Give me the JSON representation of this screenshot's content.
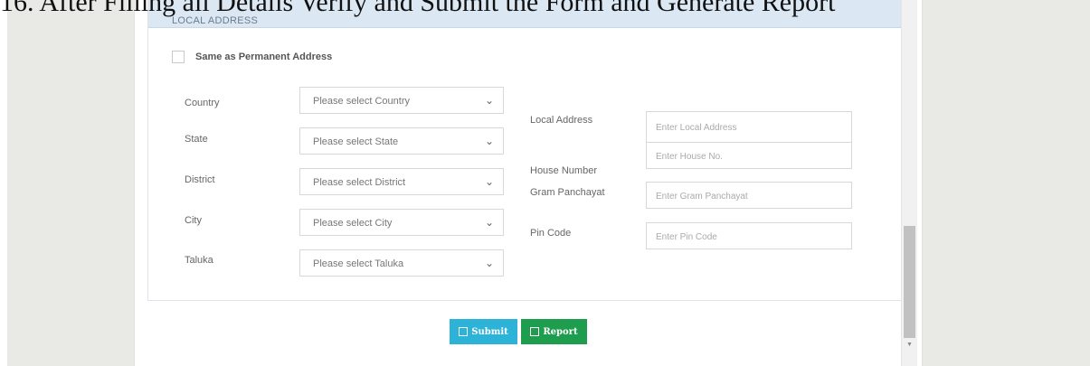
{
  "heading": "16. After Filling all Details Verify and Submit the Form and Generate Report",
  "section_title": "LOCAL ADDRESS",
  "same_as_permanent_label": "Same as Permanent Address",
  "left_fields": [
    {
      "label": "Country",
      "value": "Please select Country"
    },
    {
      "label": "State",
      "value": "Please select State"
    },
    {
      "label": "District",
      "value": "Please select District"
    },
    {
      "label": "City",
      "value": "Please select City"
    },
    {
      "label": "Taluka",
      "value": "Please select Taluka"
    }
  ],
  "right_fields": [
    {
      "label": "Local Address",
      "placeholder": "Enter Local Address"
    },
    {
      "label": "House Number",
      "placeholder": "Enter House No."
    },
    {
      "label": "Gram Panchayat",
      "placeholder": "Enter Gram Panchayat"
    },
    {
      "label": "Pin Code",
      "placeholder": "Enter Pin Code"
    }
  ],
  "buttons": {
    "submit": "Submit",
    "report": "Report"
  },
  "colors": {
    "header_bg": "#dbe8f4",
    "submit_bg": "#2eb3d8",
    "report_bg": "#1e9d4f"
  },
  "icons": {
    "select_arrow": "chevron-down-icon",
    "button_icon": "save-icon"
  }
}
